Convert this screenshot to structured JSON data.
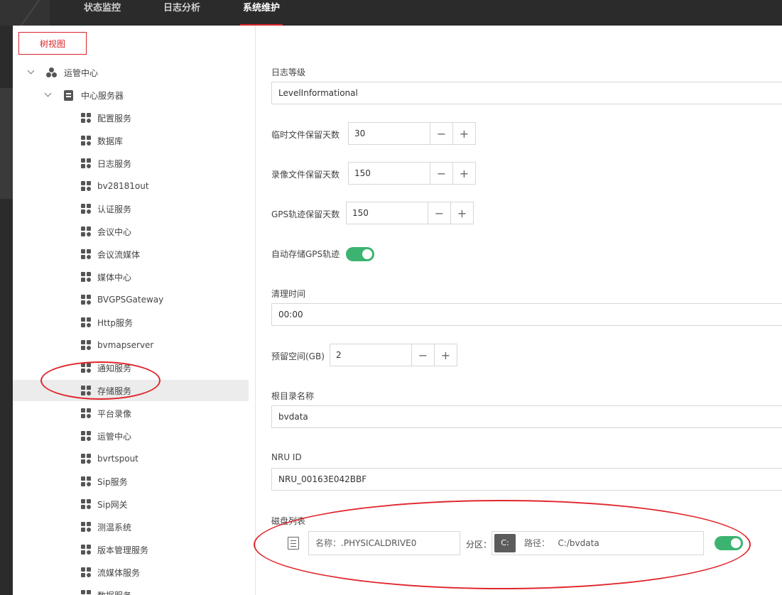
{
  "nav": {
    "tabs": [
      {
        "label": "状态监控"
      },
      {
        "label": "日志分析"
      },
      {
        "label": "系统维护",
        "active": true
      }
    ]
  },
  "sidebar": {
    "tree_button": "树视图",
    "root": {
      "label": "运管中心"
    },
    "server": {
      "label": "中心服务器"
    },
    "services": [
      "配置服务",
      "数据库",
      "日志服务",
      "bv28181out",
      "认证服务",
      "会议中心",
      "会议流媒体",
      "媒体中心",
      "BVGPSGateway",
      "Http服务",
      "bvmapserver",
      "通知服务",
      "存储服务",
      "平台录像",
      "运管中心",
      "bvrtspout",
      "Sip服务",
      "Sip网关",
      "测温系统",
      "版本管理服务",
      "流媒体服务",
      "数据服务"
    ],
    "selected": "存储服务"
  },
  "form": {
    "log_level": {
      "label": "日志等级",
      "value": "LevelInformational"
    },
    "temp_days": {
      "label": "临时文件保留天数",
      "value": "30"
    },
    "record_days": {
      "label": "录像文件保留天数",
      "value": "150"
    },
    "gps_days": {
      "label": "GPS轨迹保留天数",
      "value": "150"
    },
    "auto_gps": {
      "label": "自动存储GPS轨迹",
      "enabled": true
    },
    "clean_time": {
      "label": "清理时间",
      "value": "00:00"
    },
    "reserve_space": {
      "label": "预留空间(GB)",
      "value": "2"
    },
    "root_dir": {
      "label": "根目录名称",
      "value": "bvdata"
    },
    "nru_id": {
      "label": "NRU ID",
      "value": "NRU_00163E042BBF"
    },
    "disk_list": {
      "label": "磁盘列表",
      "name_label": "名称：",
      "name_value": ".PHYSICALDRIVE0",
      "partition_label": "分区：",
      "drive": "C:",
      "path_label": "路径：",
      "path_value": "C:/bvdata",
      "enabled": true
    }
  },
  "stepper": {
    "minus": "−",
    "plus": "+"
  },
  "colors": {
    "accent": "#d9242a",
    "toggle_on": "#3cb371",
    "nav_bg": "#2b2b2b"
  }
}
